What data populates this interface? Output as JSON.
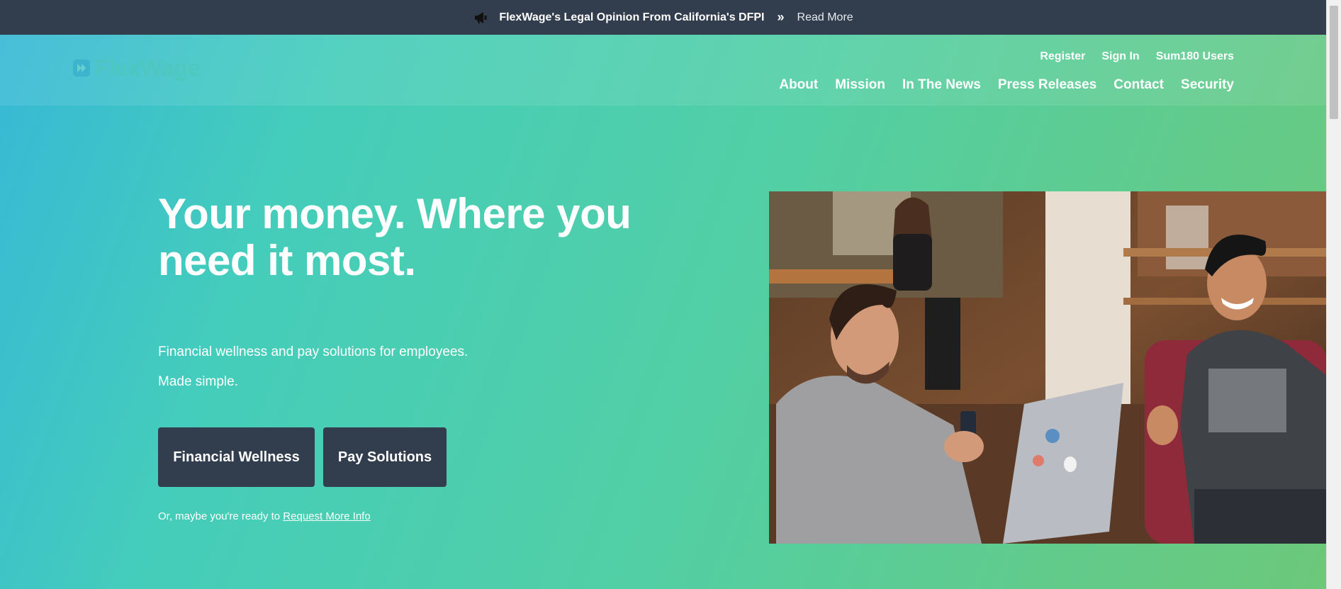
{
  "announcement": {
    "icon": "megaphone-icon",
    "headline": "FlexWage's Legal Opinion From California's DFPI",
    "separator": "»",
    "link": "Read More"
  },
  "header": {
    "logo_text": "FlexWage",
    "utility_nav": [
      "Register",
      "Sign In",
      "Sum180 Users"
    ],
    "main_nav": [
      "About",
      "Mission",
      "In The News",
      "Press Releases",
      "Contact",
      "Security"
    ]
  },
  "hero": {
    "title": "Your money. Where you need it most.",
    "subtitle": "Financial wellness and pay solutions for employees.",
    "subtitle2": "Made simple.",
    "buttons": {
      "financial_wellness": "Financial Wellness",
      "pay_solutions": "Pay Solutions"
    },
    "more_info_prefix": "Or, maybe you're ready to",
    "more_info_link": "Request More Info"
  },
  "colors": {
    "announcement_bg": "#323d4d",
    "button_bg": "#323d4d",
    "gradient_start": "#37b8d6",
    "gradient_end": "#6cc87a"
  }
}
